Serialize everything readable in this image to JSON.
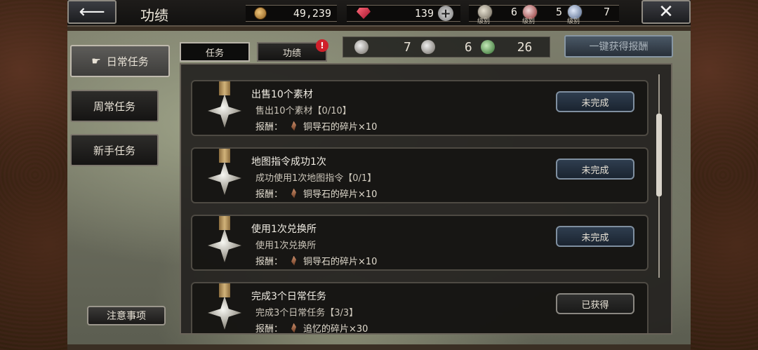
{
  "header": {
    "title": "功绩",
    "back_icon": "back-arrow-icon",
    "close_icon": "close-icon",
    "coins": "49,239",
    "gems": "139",
    "level_caption": "级别",
    "levels": [
      "6",
      "5",
      "7"
    ]
  },
  "sidebar": {
    "items": [
      {
        "label": "日常任务",
        "active": true
      },
      {
        "label": "周常任务",
        "active": false
      },
      {
        "label": "新手任务",
        "active": false
      }
    ],
    "notice_label": "注意事项"
  },
  "tabs": [
    {
      "label": "任务",
      "active": true
    },
    {
      "label": "功绩",
      "active": false,
      "alert": "!"
    }
  ],
  "summary": {
    "values": [
      "7",
      "6",
      "26"
    ]
  },
  "claim_all_label": "一键获得报酬",
  "tasks": [
    {
      "name": "出售10个素材",
      "desc": "售出10个素材【0/10】",
      "reward_label": "报酬：",
      "reward": "铜导石的碎片×10",
      "status": "未完成"
    },
    {
      "name": "地图指令成功1次",
      "desc": "成功使用1次地图指令【0/1】",
      "reward_label": "报酬：",
      "reward": "铜导石的碎片×10",
      "status": "未完成"
    },
    {
      "name": "使用1次兑换所",
      "desc": "使用1次兑换所",
      "reward_label": "报酬：",
      "reward": "铜导石的碎片×10",
      "status": "未完成"
    },
    {
      "name": "完成3个日常任务",
      "desc": "完成3个日常任务【3/3】",
      "reward_label": "报酬：",
      "reward": "追忆的碎片×30",
      "status": "已获得"
    }
  ]
}
